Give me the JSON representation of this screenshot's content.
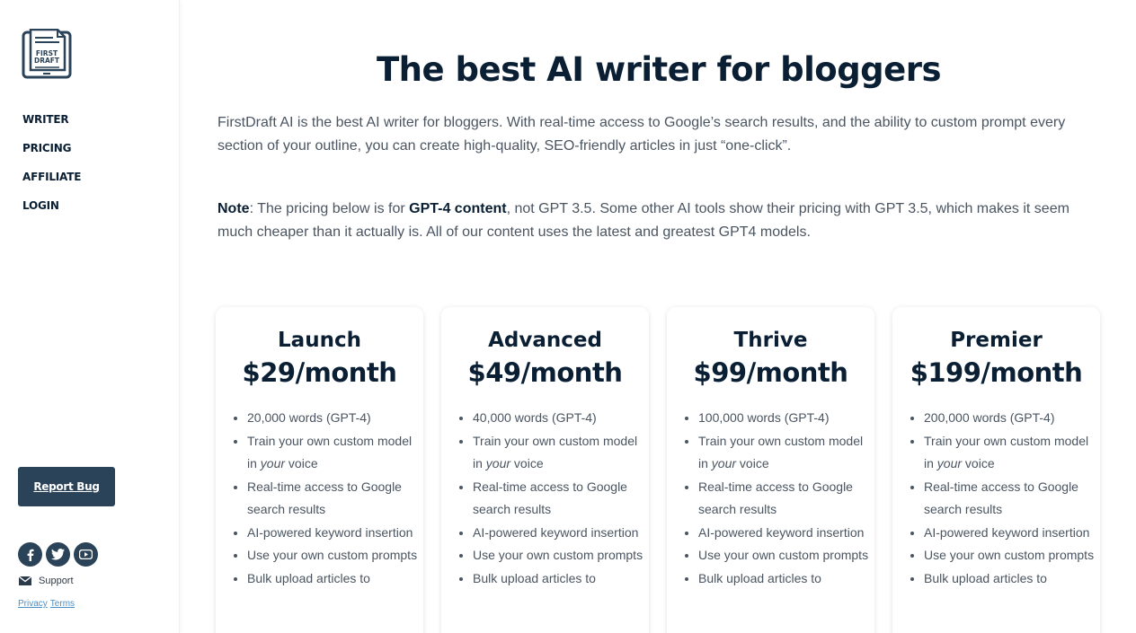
{
  "sidebar": {
    "logo_lines": [
      "FIRST",
      "DRAFT"
    ],
    "nav": [
      {
        "label": "WRITER"
      },
      {
        "label": "PRICING"
      },
      {
        "label": "AFFILIATE"
      },
      {
        "label": "LOGIN"
      }
    ],
    "report_bug": "Report Bug",
    "socials": [
      {
        "icon": "facebook-icon"
      },
      {
        "icon": "twitter-icon"
      },
      {
        "icon": "youtube-icon"
      }
    ],
    "support_label": "Support",
    "privacy": "Privacy",
    "terms": "Terms"
  },
  "main": {
    "title": "The best AI writer for bloggers",
    "intro": "FirstDraft AI is the best AI writer for bloggers. With real-time access to Google’s search results, and the ability to custom prompt every section of your outline, you can create high-quality, SEO-friendly articles in just “one-click”.",
    "note": {
      "label": "Note",
      "text_1": ": The pricing below is for ",
      "bold": "GPT-4 content",
      "text_2": ", not GPT 3.5. Some other AI tools show their pricing with GPT 3.5, which makes it seem much cheaper than it actually is. All of our content uses the latest and greatest GPT4 models."
    }
  },
  "plans": [
    {
      "name": "Launch",
      "price": "$29/month",
      "words": "20,000 words (GPT-4)"
    },
    {
      "name": "Advanced",
      "price": "$49/month",
      "words": "40,000 words (GPT-4)"
    },
    {
      "name": "Thrive",
      "price": "$99/month",
      "words": "100,000 words (GPT-4)"
    },
    {
      "name": "Premier",
      "price": "$199/month",
      "words": "200,000 words (GPT-4)"
    }
  ],
  "features": {
    "train_1": "Train your own custom model in ",
    "train_em": "your",
    "train_2": " voice",
    "google": "Real-time access to Google search results",
    "keyword": "AI-powered keyword insertion",
    "prompts": "Use your own custom prompts",
    "bulk": "Bulk upload articles to"
  },
  "colors": {
    "navy": "#0a1f33",
    "button": "#2b4358",
    "body_text": "#4a5561",
    "link": "#4a90c8"
  }
}
